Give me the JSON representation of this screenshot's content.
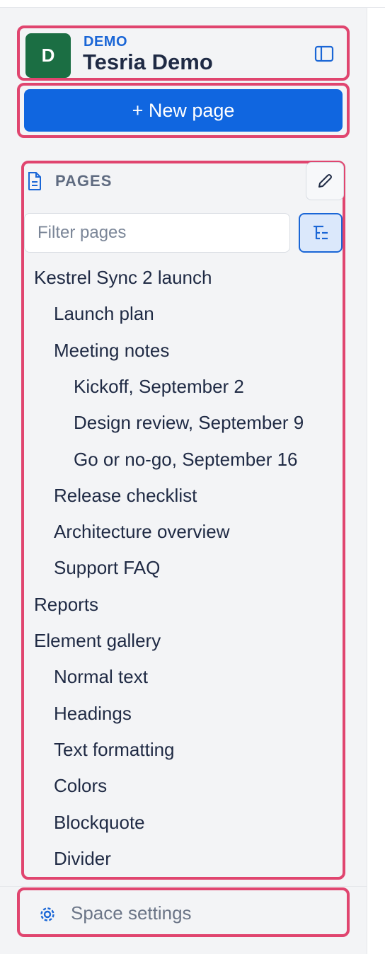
{
  "space": {
    "avatar_letter": "D",
    "kicker": "DEMO",
    "name": "Tesria Demo"
  },
  "actions": {
    "new_page": "+ New page"
  },
  "pages": {
    "title": "PAGES",
    "filter_placeholder": "Filter pages",
    "items": [
      {
        "label": "Kestrel Sync 2 launch",
        "level": 0
      },
      {
        "label": "Launch plan",
        "level": 1
      },
      {
        "label": "Meeting notes",
        "level": 1
      },
      {
        "label": "Kickoff, September 2",
        "level": 2
      },
      {
        "label": "Design review, September 9",
        "level": 2
      },
      {
        "label": "Go or no-go, September 16",
        "level": 2
      },
      {
        "label": "Release checklist",
        "level": 1
      },
      {
        "label": "Architecture overview",
        "level": 1
      },
      {
        "label": "Support FAQ",
        "level": 1
      },
      {
        "label": "Reports",
        "level": 0
      },
      {
        "label": "Element gallery",
        "level": 0
      },
      {
        "label": "Normal text",
        "level": 1
      },
      {
        "label": "Headings",
        "level": 1
      },
      {
        "label": "Text formatting",
        "level": 1
      },
      {
        "label": "Colors",
        "level": 1
      },
      {
        "label": "Blockquote",
        "level": 1
      },
      {
        "label": "Divider",
        "level": 1
      }
    ]
  },
  "footer": {
    "settings_label": "Space settings"
  },
  "colors": {
    "accent": "#1066e0",
    "avatar": "#1b6e43",
    "highlight": "#e0456f"
  },
  "icons": [
    "document-icon",
    "pencil-icon",
    "tree-view-icon",
    "sidebar-toggle-icon",
    "gear-icon"
  ]
}
